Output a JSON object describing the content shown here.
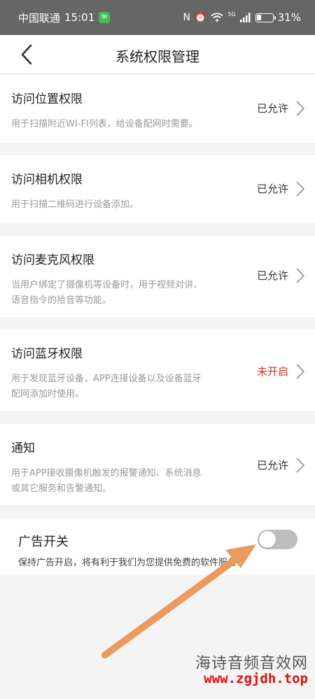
{
  "status_bar": {
    "carrier": "中国联通",
    "time": "15:01",
    "wechat_glyph": "✉",
    "nfc_glyph": "N",
    "alarm_glyph": "⏰",
    "network_label": "5G",
    "battery_percent": 31,
    "battery_text": "31%"
  },
  "nav": {
    "title": "系统权限管理"
  },
  "permissions": [
    {
      "title": "访问位置权限",
      "desc_lines": [
        "用于扫描附近WI-FI列表，给设备配网时需要。"
      ],
      "status": "已允许",
      "enabled": true
    },
    {
      "title": "访问相机权限",
      "desc_lines": [
        "用于扫描二维码进行设备添加。"
      ],
      "status": "已允许",
      "enabled": true
    },
    {
      "title": "访问麦克风权限",
      "desc_lines": [
        "当用户绑定了摄像机等设备时，用于视频对讲、",
        "语音指令的拾音等功能。"
      ],
      "status": "已允许",
      "enabled": true
    },
    {
      "title": "访问蓝牙权限",
      "desc_lines": [
        "用于发现蓝牙设备，APP连接设备以及设备蓝牙",
        "配网添加时使用。"
      ],
      "status": "未开启",
      "enabled": false
    },
    {
      "title": "通知",
      "desc_lines": [
        "用于APP接收摄像机触发的报警通知、系统消息",
        "或其它服务和告警通知。"
      ],
      "status": "已允许",
      "enabled": true
    }
  ],
  "ad_switch": {
    "title": "广告开关",
    "desc": "保持广告开启，将有利于我们为您提供免费的软件服务",
    "on": false
  },
  "watermark": {
    "name": "海诗音频音效网",
    "url": "www.zgjdh.top"
  },
  "colors": {
    "status_bar_bg": "#666666",
    "status_off": "#c23b2b",
    "arrow": "#ec9a5e",
    "watermark_url": "#e01010"
  }
}
